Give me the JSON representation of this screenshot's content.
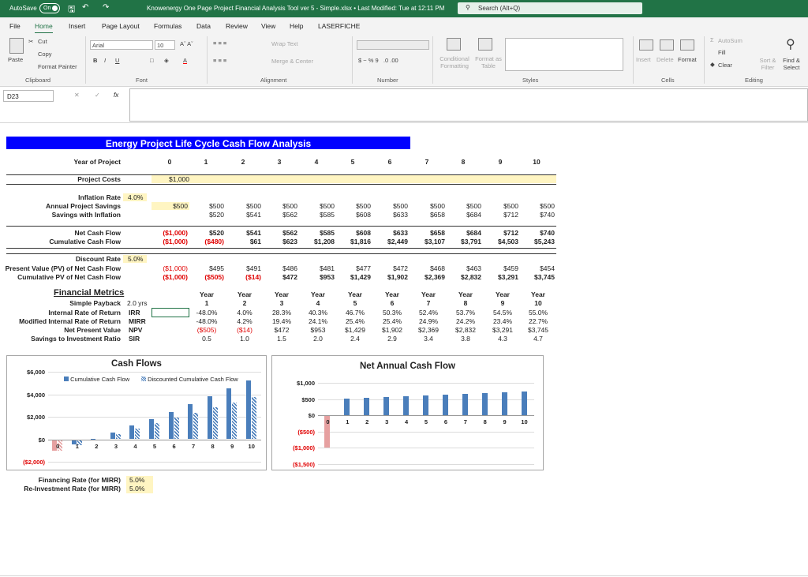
{
  "titlebar": {
    "autosave": "AutoSave",
    "toggle": "On",
    "title": "Knowenergy One Page Project Financial Analysis Tool ver 5 - Simple.xlsx • Last Modified: Tue at 12:11 PM",
    "search": "Search (Alt+Q)"
  },
  "menu": [
    "File",
    "Home",
    "Insert",
    "Page Layout",
    "Formulas",
    "Data",
    "Review",
    "View",
    "Help",
    "LASERFICHE"
  ],
  "ribbon": {
    "paste": "Paste",
    "cut": "Cut",
    "copy": "Copy",
    "format_painter": "Format Painter",
    "clipboard": "Clipboard",
    "font_name": "Arial",
    "font_size": "10",
    "font": "Font",
    "wrap_text": "Wrap Text",
    "merge_center": "Merge & Center",
    "alignment": "Alignment",
    "number": "Number",
    "cond_fmt": "Conditional Formatting",
    "fmt_table": "Format as Table",
    "styles": "Styles",
    "insert": "Insert",
    "delete": "Delete",
    "format": "Format",
    "cells": "Cells",
    "autosum": "AutoSum",
    "fill": "Fill",
    "clear": "Clear",
    "sort_filter": "Sort & Filter",
    "find_select": "Find & Select",
    "editing": "Editing"
  },
  "formula_bar": {
    "name_box": "D23",
    "fx": "fx",
    "value": ""
  },
  "sheet": {
    "banner": "Energy Project Life Cycle Cash Flow Analysis",
    "year_label": "Year of Project",
    "years": [
      "0",
      "1",
      "2",
      "3",
      "4",
      "5",
      "6",
      "7",
      "8",
      "9",
      "10"
    ],
    "project_costs_label": "Project Costs",
    "project_costs_value": "$1,000",
    "inflation_label": "Inflation Rate",
    "inflation_value": "4.0%",
    "annual_savings_label": "Annual Project Savings",
    "annual_savings": [
      "$500",
      "$500",
      "$500",
      "$500",
      "$500",
      "$500",
      "$500",
      "$500",
      "$500",
      "$500",
      "$500"
    ],
    "savings_infl_label": "Savings with Inflation",
    "savings_infl": [
      "",
      "$520",
      "$541",
      "$562",
      "$585",
      "$608",
      "$633",
      "$658",
      "$684",
      "$712",
      "$740"
    ],
    "net_cf_label": "Net Cash Flow",
    "net_cf": [
      "($1,000)",
      "$520",
      "$541",
      "$562",
      "$585",
      "$608",
      "$633",
      "$658",
      "$684",
      "$712",
      "$740"
    ],
    "cum_cf_label": "Cumulative Cash Flow",
    "cum_cf": [
      "($1,000)",
      "($480)",
      "$61",
      "$623",
      "$1,208",
      "$1,816",
      "$2,449",
      "$3,107",
      "$3,791",
      "$4,503",
      "$5,243"
    ],
    "discount_label": "Discount Rate",
    "discount_value": "5.0%",
    "pv_label": "Present Value (PV) of Net Cash Flow",
    "pv": [
      "($1,000)",
      "$495",
      "$491",
      "$486",
      "$481",
      "$477",
      "$472",
      "$468",
      "$463",
      "$459",
      "$454"
    ],
    "cum_pv_label": "Cumulative PV of Net Cash Flow",
    "cum_pv": [
      "($1,000)",
      "($505)",
      "($14)",
      "$472",
      "$953",
      "$1,429",
      "$1,902",
      "$2,369",
      "$2,832",
      "$3,291",
      "$3,745"
    ],
    "metrics_title": "Financial Metrics",
    "year_word": "Year",
    "metric_years": [
      "1",
      "2",
      "3",
      "4",
      "5",
      "6",
      "7",
      "8",
      "9",
      "10"
    ],
    "payback_label": "Simple Payback",
    "payback_value": "2.0 yrs",
    "metrics": [
      {
        "label": "Internal Rate of Return",
        "abbr": "IRR",
        "values": [
          "-48.0%",
          "4.0%",
          "28.3%",
          "40.3%",
          "46.7%",
          "50.3%",
          "52.4%",
          "53.7%",
          "54.5%",
          "55.0%"
        ]
      },
      {
        "label": "Modified Internal Rate of Return",
        "abbr": "MIRR",
        "values": [
          "-48.0%",
          "4.2%",
          "19.4%",
          "24.1%",
          "25.4%",
          "25.4%",
          "24.9%",
          "24.2%",
          "23.4%",
          "22.7%"
        ]
      },
      {
        "label": "Net Present Value",
        "abbr": "NPV",
        "values": [
          "($505)",
          "($14)",
          "$472",
          "$953",
          "$1,429",
          "$1,902",
          "$2,369",
          "$2,832",
          "$3,291",
          "$3,745"
        ]
      },
      {
        "label": "Savings to Investment Ratio",
        "abbr": "SIR",
        "values": [
          "0.5",
          "1.0",
          "1.5",
          "2.0",
          "2.4",
          "2.9",
          "3.4",
          "3.8",
          "4.3",
          "4.7"
        ]
      }
    ],
    "financing_label": "Financing Rate (for MIRR)",
    "financing_value": "5.0%",
    "reinvest_label": "Re-Investment Rate (for MIRR)",
    "reinvest_value": "5.0%"
  },
  "chart_data": [
    {
      "type": "bar",
      "title": "Cash Flows",
      "categories": [
        "0",
        "1",
        "2",
        "3",
        "4",
        "5",
        "6",
        "7",
        "8",
        "9",
        "10"
      ],
      "series": [
        {
          "name": "Cumulative Cash Flow",
          "color": "#4a7ebb",
          "values": [
            -1000,
            -480,
            61,
            623,
            1208,
            1816,
            2449,
            3107,
            3791,
            4503,
            5243
          ]
        },
        {
          "name": "Discounted Cumulative Cash Flow",
          "color": "#4a7ebb",
          "pattern": "hatched",
          "values": [
            -1000,
            -505,
            -14,
            472,
            953,
            1429,
            1902,
            2369,
            2832,
            3291,
            3745
          ]
        }
      ],
      "y_ticks": [
        "$6,000",
        "$4,000",
        "$2,000",
        "$0",
        "($2,000)"
      ],
      "ylim": [
        -2000,
        6000
      ],
      "legend": "top"
    },
    {
      "type": "bar",
      "title": "Net Annual Cash Flow",
      "categories": [
        "0",
        "1",
        "2",
        "3",
        "4",
        "5",
        "6",
        "7",
        "8",
        "9",
        "10"
      ],
      "series": [
        {
          "color": "#4a7ebb",
          "negative_color": "#e6a0a0",
          "values": [
            -1000,
            520,
            541,
            562,
            585,
            608,
            633,
            658,
            684,
            712,
            740
          ]
        }
      ],
      "y_ticks": [
        "$1,000",
        "$500",
        "$0",
        "($500)",
        "($1,000)",
        "($1,500)"
      ],
      "ylim": [
        -1500,
        1000
      ]
    }
  ]
}
